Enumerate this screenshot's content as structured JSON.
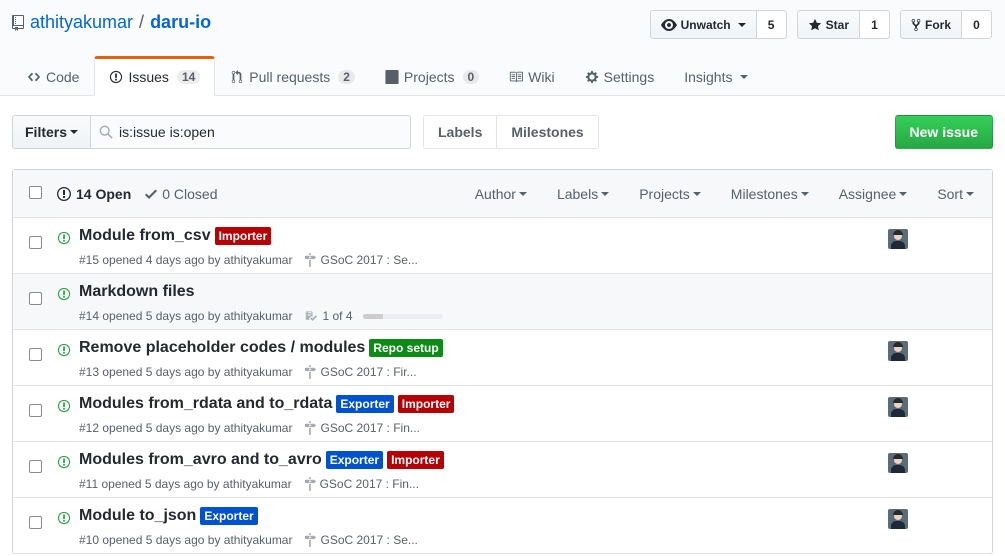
{
  "repo": {
    "owner": "athityakumar",
    "separator": "/",
    "name": "daru-io"
  },
  "actions": {
    "watch": {
      "label": "Unwatch",
      "count": "5"
    },
    "star": {
      "label": "Star",
      "count": "1"
    },
    "fork": {
      "label": "Fork",
      "count": "0"
    }
  },
  "tabs": [
    {
      "label": "Code",
      "icon": "code-icon"
    },
    {
      "label": "Issues",
      "count": "14",
      "icon": "issue-icon",
      "selected": true
    },
    {
      "label": "Pull requests",
      "count": "2",
      "icon": "pull-request-icon"
    },
    {
      "label": "Projects",
      "count": "0",
      "icon": "project-icon"
    },
    {
      "label": "Wiki",
      "icon": "book-icon"
    },
    {
      "label": "Settings",
      "icon": "gear-icon"
    },
    {
      "label": "Insights",
      "icon": "chevron-down-icon"
    }
  ],
  "subnav": {
    "filters_label": "Filters",
    "search_value": "is:issue is:open",
    "labels_link": "Labels",
    "milestones_link": "Milestones",
    "new_issue": "New issue"
  },
  "issues_header": {
    "open_label": "14 Open",
    "closed_label": "0 Closed",
    "menus": [
      "Author",
      "Labels",
      "Projects",
      "Milestones",
      "Assignee",
      "Sort"
    ]
  },
  "issues": [
    {
      "title": "Module from_csv",
      "labels": [
        {
          "name": "Importer",
          "color": "#b60205"
        }
      ],
      "meta": "#15 opened 4 days ago by athityakumar",
      "milestone": "GSoC 2017 : Se...",
      "avatar": true
    },
    {
      "title": "Markdown files",
      "labels": [],
      "meta": "#14 opened 5 days ago by athityakumar",
      "tasks": "1 of 4",
      "task_progress": 0.25,
      "avatar": false
    },
    {
      "title": "Remove placeholder codes / modules",
      "labels": [
        {
          "name": "Repo setup",
          "color": "#0e8a16"
        }
      ],
      "meta": "#13 opened 5 days ago by athityakumar",
      "milestone": "GSoC 2017 : Fir...",
      "avatar": true
    },
    {
      "title": "Modules from_rdata and to_rdata",
      "labels": [
        {
          "name": "Exporter",
          "color": "#0052cc"
        },
        {
          "name": "Importer",
          "color": "#b60205"
        }
      ],
      "meta": "#12 opened 5 days ago by athityakumar",
      "milestone": "GSoC 2017 : Fin...",
      "avatar": true
    },
    {
      "title": "Modules from_avro and to_avro",
      "labels": [
        {
          "name": "Exporter",
          "color": "#0052cc"
        },
        {
          "name": "Importer",
          "color": "#b60205"
        }
      ],
      "meta": "#11 opened 5 days ago by athityakumar",
      "milestone": "GSoC 2017 : Fin...",
      "avatar": true
    },
    {
      "title": "Module to_json",
      "labels": [
        {
          "name": "Exporter",
          "color": "#0052cc"
        }
      ],
      "meta": "#10 opened 5 days ago by athityakumar",
      "milestone": "GSoC 2017 : Se...",
      "avatar": true
    }
  ],
  "colors": {
    "link": "#0366d6",
    "open_icon": "#28a745",
    "accent_tab": "#e36209"
  }
}
